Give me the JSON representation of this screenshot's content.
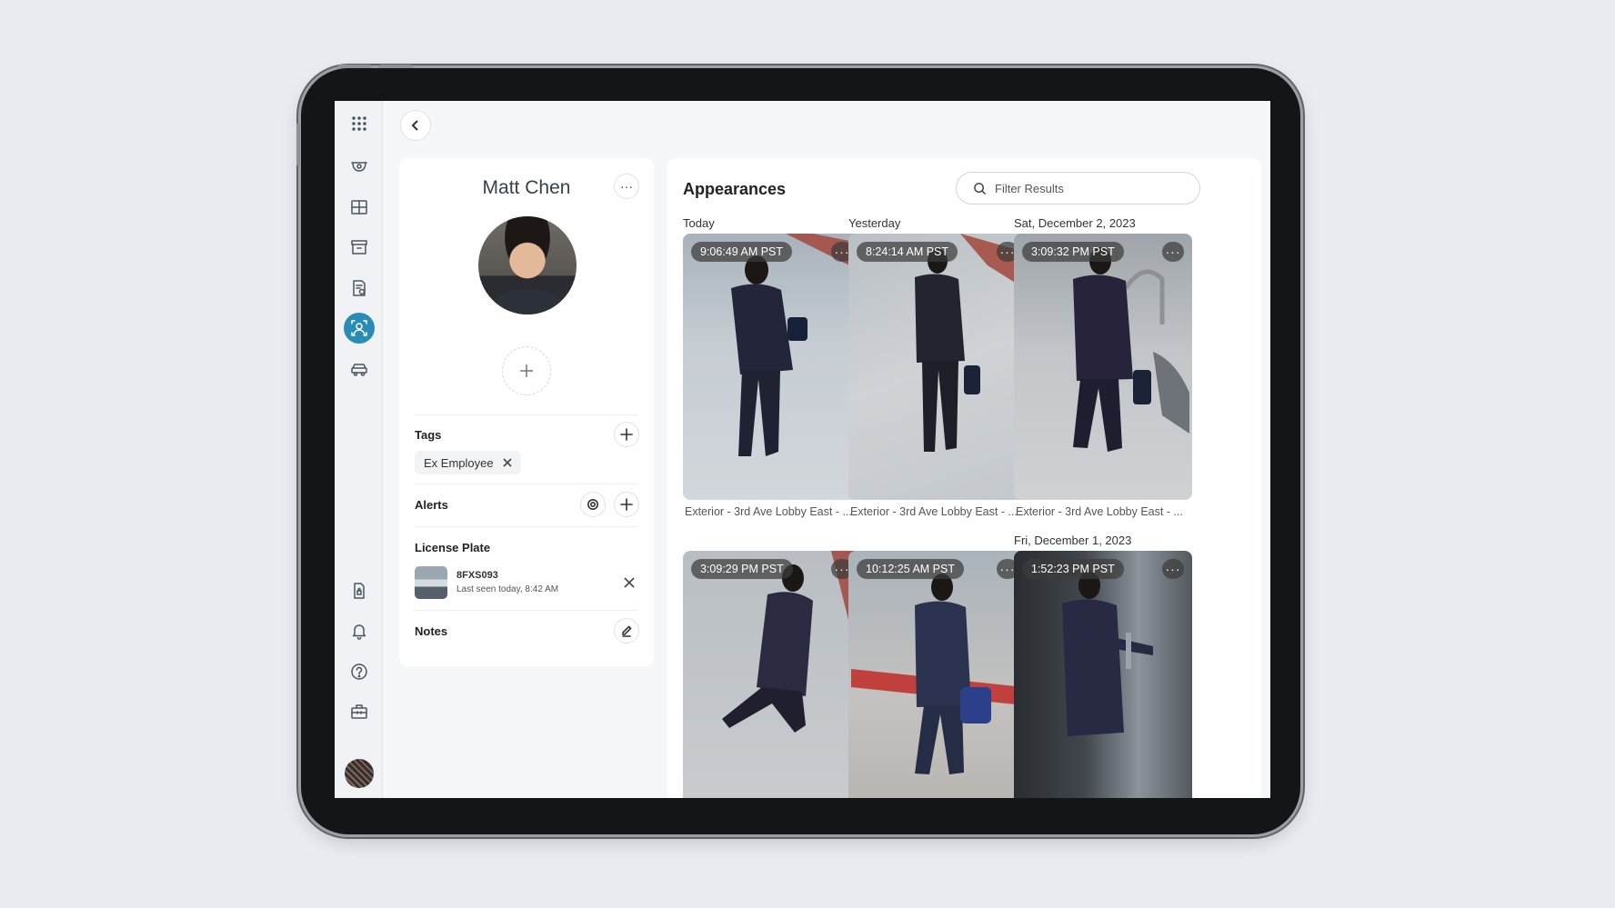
{
  "profile": {
    "name": "Matt Chen",
    "more_label": "···",
    "tags_label": "Tags",
    "tags": [
      {
        "label": "Ex Employee"
      }
    ],
    "alerts_label": "Alerts",
    "license_plate_label": "License Plate",
    "plate": {
      "number": "8FXS093",
      "last_seen": "Last seen today, 8:42 AM"
    },
    "notes_label": "Notes"
  },
  "appearances": {
    "title": "Appearances",
    "filter_placeholder": "Filter Results",
    "more_label": "···",
    "day_labels": [
      "Today",
      "Yesterday",
      "Sat, December 2, 2023",
      "Fri, December 1, 2023"
    ],
    "items": [
      {
        "time": "9:06:49 AM PST",
        "camera": "Exterior - 3rd Ave Lobby East - ..."
      },
      {
        "time": "8:24:14 AM PST",
        "camera": "Exterior - 3rd Ave Lobby East - ..."
      },
      {
        "time": "3:09:32 PM PST",
        "camera": "Exterior - 3rd Ave Lobby East - ..."
      },
      {
        "time": "3:09:29 PM PST",
        "camera": ""
      },
      {
        "time": "10:12:25 AM PST",
        "camera": ""
      },
      {
        "time": "1:52:23 PM PST",
        "camera": ""
      }
    ]
  },
  "sidebar": {
    "icons": [
      "apps-grid-icon",
      "camera-dome-icon",
      "layout-grid-icon",
      "archive-icon",
      "report-icon",
      "people-analytics-icon",
      "vehicle-icon",
      "access-doc-icon",
      "bell-icon",
      "help-icon",
      "toolbox-icon"
    ],
    "active": "people-analytics-icon"
  },
  "colors": {
    "accent": "#2a8bb4",
    "background": "#e9edf1",
    "panel": "#ffffff"
  }
}
